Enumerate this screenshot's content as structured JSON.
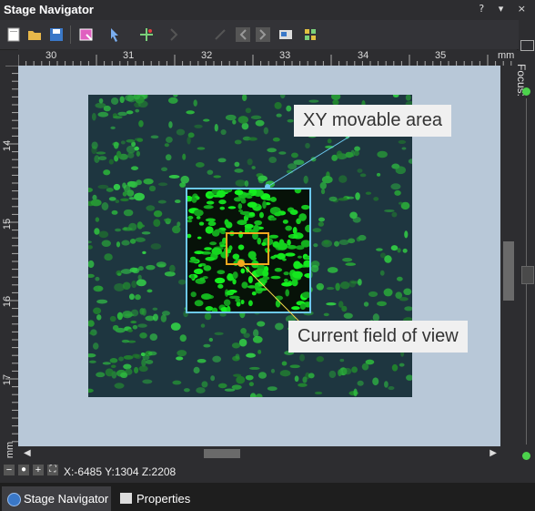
{
  "window": {
    "title": "Stage Navigator",
    "controls": "? ▾ ×"
  },
  "toolbar": {
    "icons": [
      "new-icon",
      "open-folder-icon",
      "save-icon",
      "select-region-icon",
      "pointer-icon",
      "move-icon",
      "arrow-icon",
      "line-icon",
      "back-icon",
      "forward-icon",
      "image-icon",
      "grid-icon"
    ]
  },
  "ruler": {
    "x_ticks": [
      "30",
      "31",
      "32",
      "33",
      "34",
      "35"
    ],
    "x_unit": "mm",
    "y_ticks": [
      "14",
      "15",
      "16",
      "17"
    ],
    "y_unit": "mm"
  },
  "callouts": {
    "movable": "XY movable area",
    "fov": "Current field of view"
  },
  "focus": {
    "label": "Focus:"
  },
  "status": {
    "coords": "X:-6485 Y:1304 Z:2208"
  },
  "tabs": [
    {
      "label": "Stage Navigator",
      "active": true
    },
    {
      "label": "Properties",
      "active": false
    }
  ],
  "colors": {
    "movable_border": "#6cc8ee",
    "fov_border": "#f2a81e",
    "cells": "#2fbf3f"
  }
}
